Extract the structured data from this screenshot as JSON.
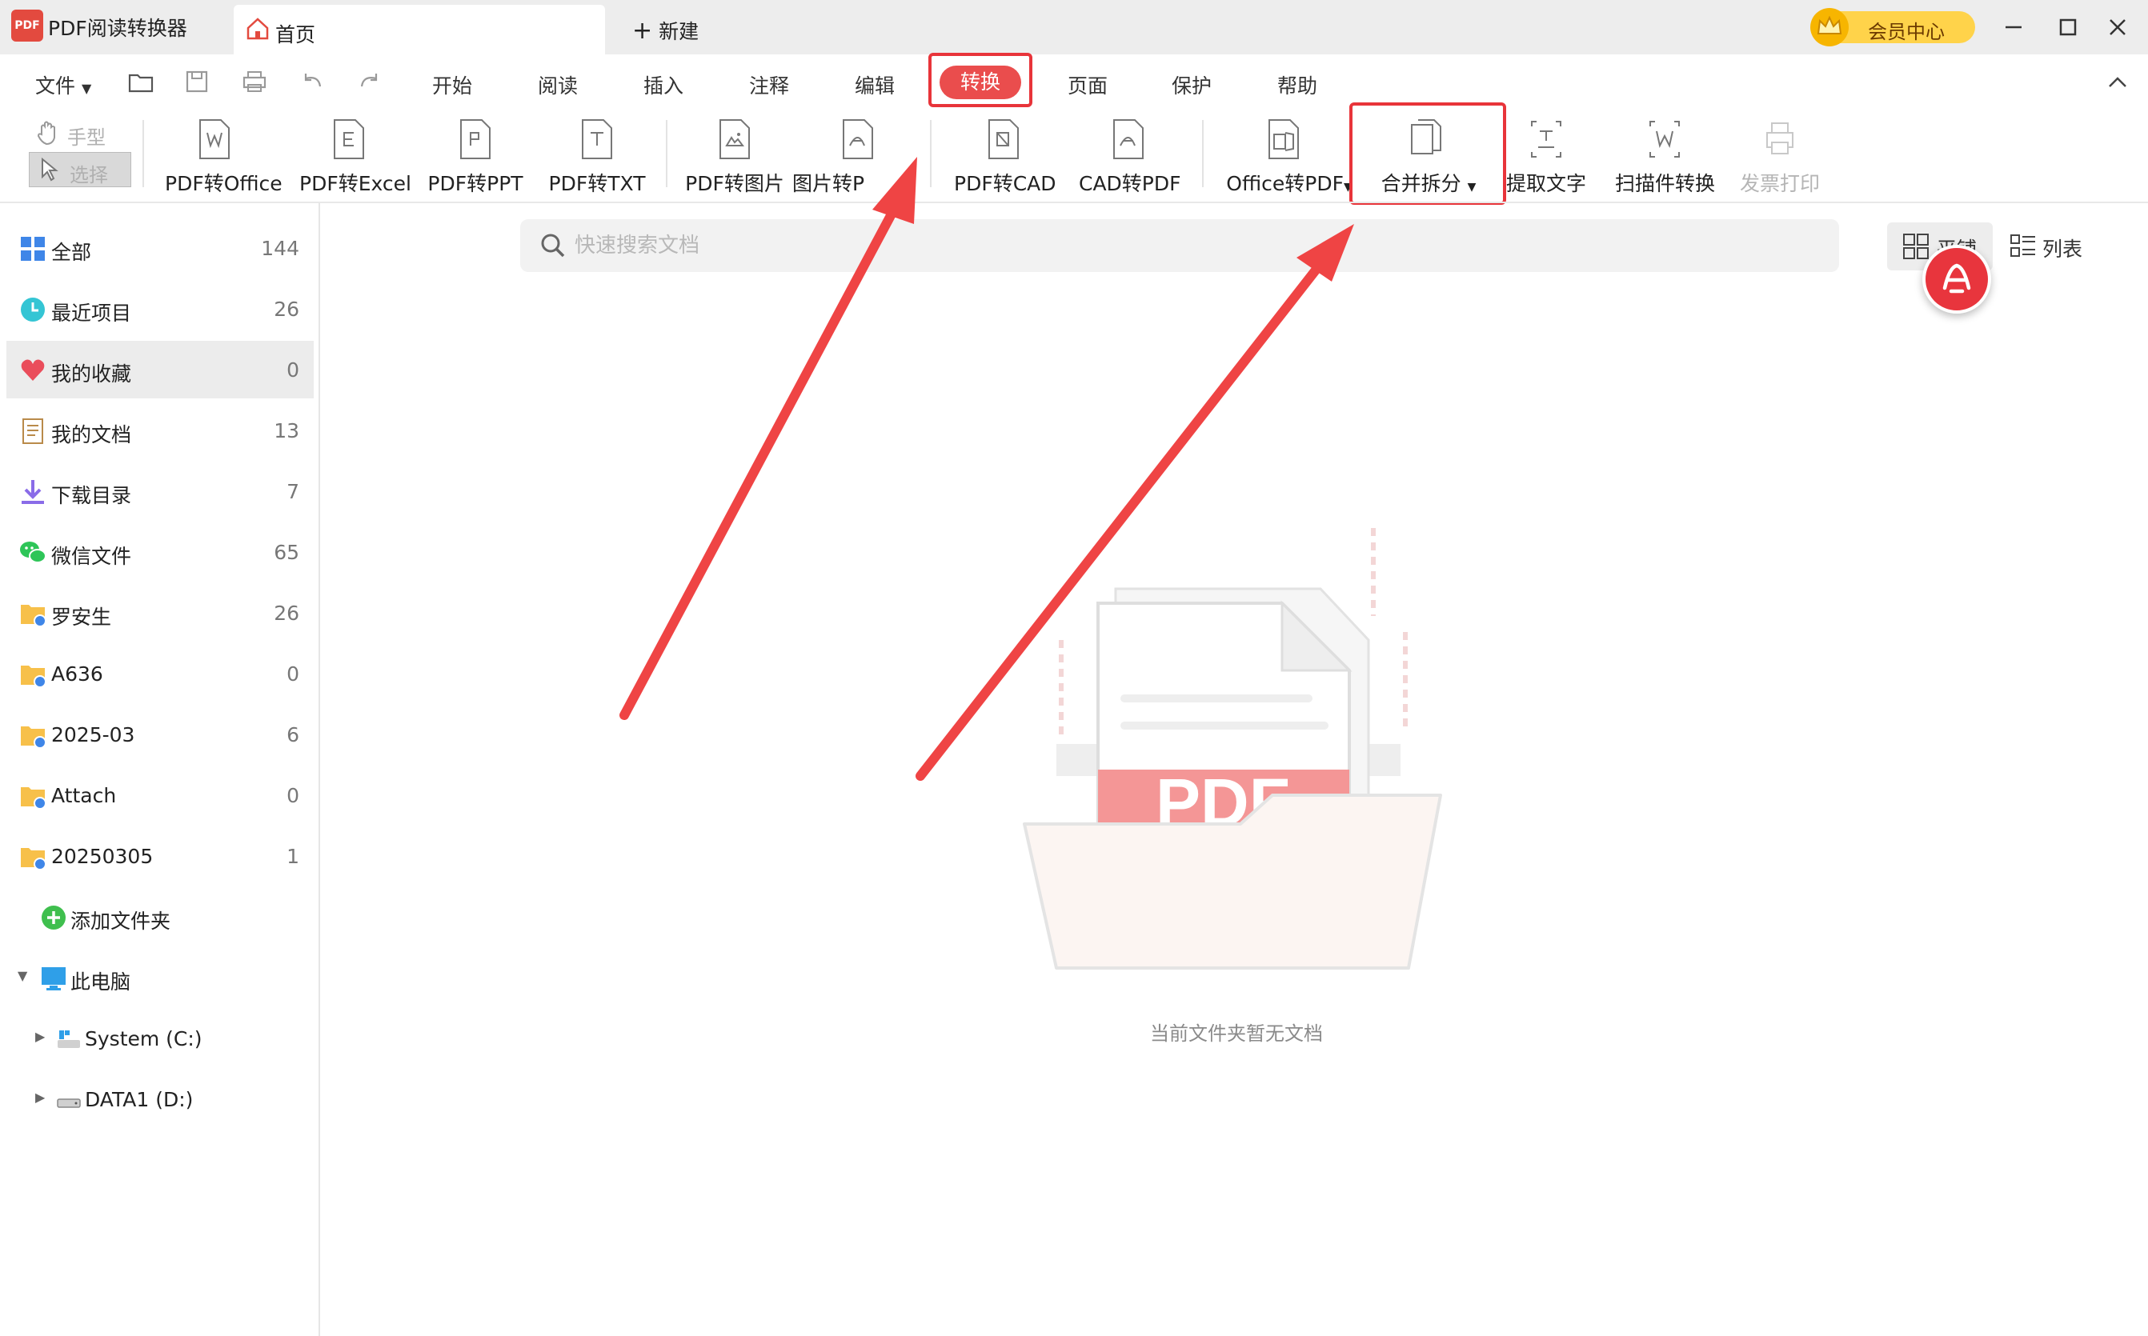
{
  "app": {
    "title": "PDF阅读转换器",
    "logo_text": "PDF"
  },
  "tabs": {
    "home_label": "首页",
    "new_label": "新建"
  },
  "vip": {
    "label": "会员中心"
  },
  "menu": {
    "file_label": "文件",
    "items": [
      "开始",
      "阅读",
      "插入",
      "注释",
      "编辑",
      "转换",
      "页面",
      "保护",
      "帮助"
    ],
    "active": "转换"
  },
  "tools": {
    "hand_label": "手型",
    "select_label": "选择",
    "items": [
      {
        "label": "PDF转Office",
        "icon": "word-doc-icon"
      },
      {
        "label": "PDF转Excel",
        "icon": "excel-doc-icon"
      },
      {
        "label": "PDF转PPT",
        "icon": "ppt-doc-icon"
      },
      {
        "label": "PDF转TXT",
        "icon": "txt-doc-icon"
      },
      {
        "label": "PDF转图片",
        "icon": "image-doc-icon"
      },
      {
        "label": "图片转P",
        "icon": "pdf-doc-icon"
      },
      {
        "label": "PDF转CAD",
        "icon": "cad-doc-icon"
      },
      {
        "label": "CAD转PDF",
        "icon": "pdf-doc-icon"
      },
      {
        "label": "Office转PDF",
        "icon": "office-doc-icon"
      },
      {
        "label": "合并拆分",
        "icon": "merge-split-icon"
      },
      {
        "label": "提取文字",
        "icon": "extract-text-icon"
      },
      {
        "label": "扫描件转换",
        "icon": "scan-convert-icon"
      },
      {
        "label": "发票打印",
        "icon": "invoice-print-icon"
      }
    ]
  },
  "sidebar": {
    "items": [
      {
        "label": "全部",
        "count": "144"
      },
      {
        "label": "最近项目",
        "count": "26"
      },
      {
        "label": "我的收藏",
        "count": "0"
      },
      {
        "label": "我的文档",
        "count": "13"
      },
      {
        "label": "下载目录",
        "count": "7"
      },
      {
        "label": "微信文件",
        "count": "65"
      },
      {
        "label": "罗安生",
        "count": "26"
      },
      {
        "label": "A636",
        "count": "0"
      },
      {
        "label": "2025-03",
        "count": "6"
      },
      {
        "label": "Attach",
        "count": "0"
      },
      {
        "label": "20250305",
        "count": "1"
      }
    ],
    "add_folder": "添加文件夹",
    "this_pc": "此电脑",
    "drives": [
      "System (C:)",
      "DATA1 (D:)"
    ]
  },
  "main": {
    "search_placeholder": "快速搜索文档",
    "view_tile": "平铺",
    "view_list": "列表",
    "empty_text": "当前文件夹暂无文档",
    "illustration_text": "PDF"
  },
  "colors": {
    "accent": "#e8343a",
    "arrow": "#ef4444",
    "vip": "#ffd34a"
  }
}
